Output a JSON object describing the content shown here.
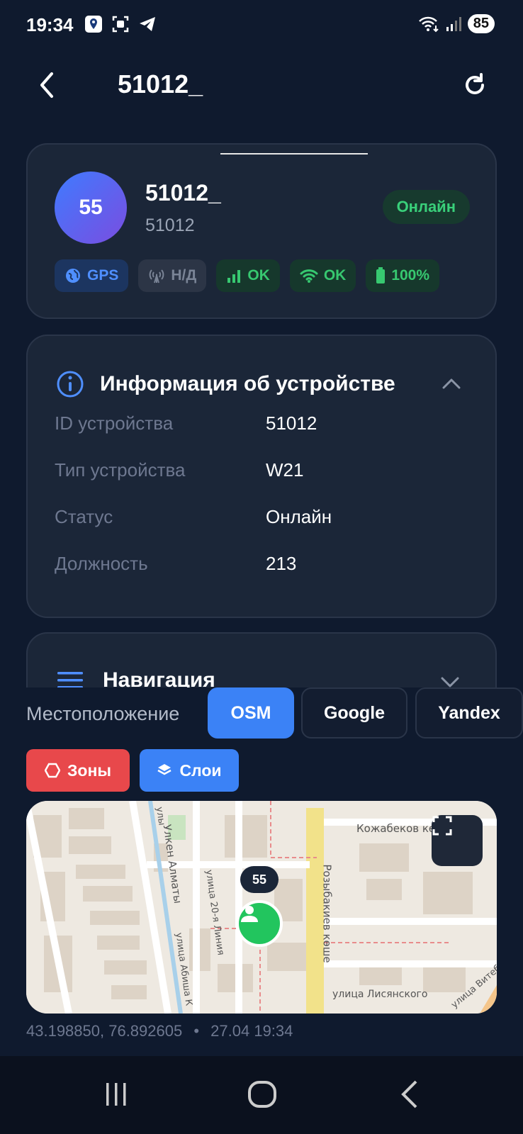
{
  "status_bar": {
    "time": "19:34",
    "battery": "85"
  },
  "header": {
    "title": "51012_"
  },
  "device": {
    "avatar_text": "55",
    "name": "51012_",
    "id": "51012",
    "status": "Онлайн",
    "chips": {
      "gps": "GPS",
      "antenna": "Н/Д",
      "signal": "OK",
      "wifi": "OK",
      "battery": "100%"
    }
  },
  "info": {
    "title": "Информация об устройстве",
    "rows": [
      {
        "label": "ID устройства",
        "value": "51012"
      },
      {
        "label": "Тип устройства",
        "value": "W21"
      },
      {
        "label": "Статус",
        "value": "Онлайн"
      },
      {
        "label": "Должность",
        "value": "213"
      }
    ]
  },
  "navigation": {
    "title": "Навигация"
  },
  "location": {
    "label": "Местоположение",
    "providers": [
      "OSM",
      "Google",
      "Yandex"
    ],
    "selected_provider": "OSM",
    "zones_label": "Зоны",
    "layers_label": "Слои",
    "marker_label": "55",
    "streets": {
      "s1": "Кожабеков көшесі",
      "s2": "Улкен Алматы",
      "s3": "улица 20-я Линия",
      "s4": "Розыбакиев көше",
      "s5": "улица Лисянского",
      "s6": "улица Абиша К",
      "s7": "улица Витебск",
      "s8": "улы"
    },
    "coords": "43.198850, 76.892605",
    "separator": "•",
    "timestamp": "27.04 19:34"
  },
  "colors": {
    "background": "#0f1a2e",
    "card": "#1b2638",
    "accent": "#3b82f6",
    "online": "#39d07a",
    "danger": "#e8484b"
  }
}
